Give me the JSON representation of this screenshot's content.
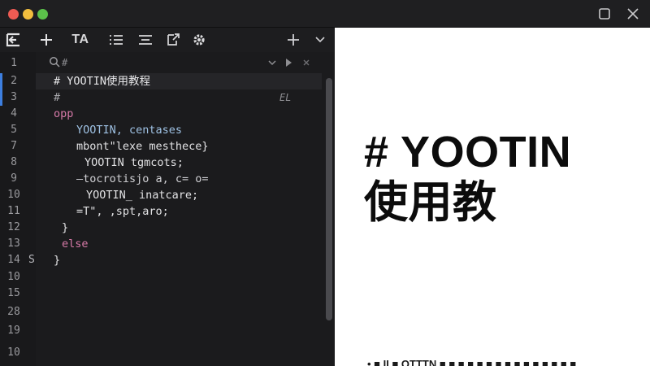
{
  "window": {
    "controls": [
      "close",
      "minimize",
      "zoom"
    ],
    "right_icons": [
      "maximize-icon",
      "close-icon"
    ]
  },
  "toolbar": {
    "logo_icon": "editor-logo-icon",
    "items": [
      {
        "name": "add-icon"
      },
      {
        "name": "text-format",
        "label": "TA"
      },
      {
        "name": "list-icon"
      },
      {
        "name": "align-icon"
      },
      {
        "name": "export-icon"
      },
      {
        "name": "settings-icon"
      }
    ],
    "right_items": [
      {
        "name": "new-tab-icon"
      },
      {
        "name": "chevron-down-icon"
      }
    ]
  },
  "find": {
    "placeholder": "#",
    "icons": [
      "search-icon",
      "chevron-down-icon",
      "play-icon",
      "close-icon"
    ]
  },
  "gutter": {
    "line_numbers": [
      "1",
      "2",
      "3",
      "4",
      "5",
      "7",
      "8",
      "9",
      "10",
      "11",
      "12",
      "13",
      "14",
      "10",
      "15",
      "28",
      "19",
      "10"
    ],
    "side_letter": "S"
  },
  "code": {
    "lines": [
      {
        "text": "# YOOTIN使用教程",
        "color": "white"
      },
      {
        "text": "#",
        "color": "gray"
      },
      {
        "text": "opp",
        "color": "pink"
      },
      {
        "text": "YOOTIN, centases",
        "color": "blue"
      },
      {
        "text": "mbont\"lexe mesthece}",
        "color": "light"
      },
      {
        "text": "YOOTIN tgmcots;",
        "color": "light"
      },
      {
        "text": "—tocrotisjo a, c= o=",
        "color": "dim"
      },
      {
        "text": "YOOTIN_ inatcare;",
        "color": "light"
      },
      {
        "text": "=T\", ,spt,aro;",
        "color": "light"
      },
      {
        "text": "}",
        "color": "light"
      },
      {
        "text": "else",
        "color": "pink"
      },
      {
        "text": "}",
        "color": "light"
      }
    ],
    "marker_text": "EL"
  },
  "preview": {
    "heading_line1": "# YOOTIN",
    "heading_line2": "使用教",
    "bottom_text": "• ■ II ■ OTTTN ■ ■ ■ ■ ■ ■ ■ ■ ■ ■ ■ ■ ■ ■ ■"
  },
  "colors": {
    "editor_bg": "#1b1b1d",
    "preview_bg": "#ffffff",
    "accent": "#3d7fe0",
    "keyword": "#d77aa8",
    "identifier": "#9fc2e4"
  }
}
